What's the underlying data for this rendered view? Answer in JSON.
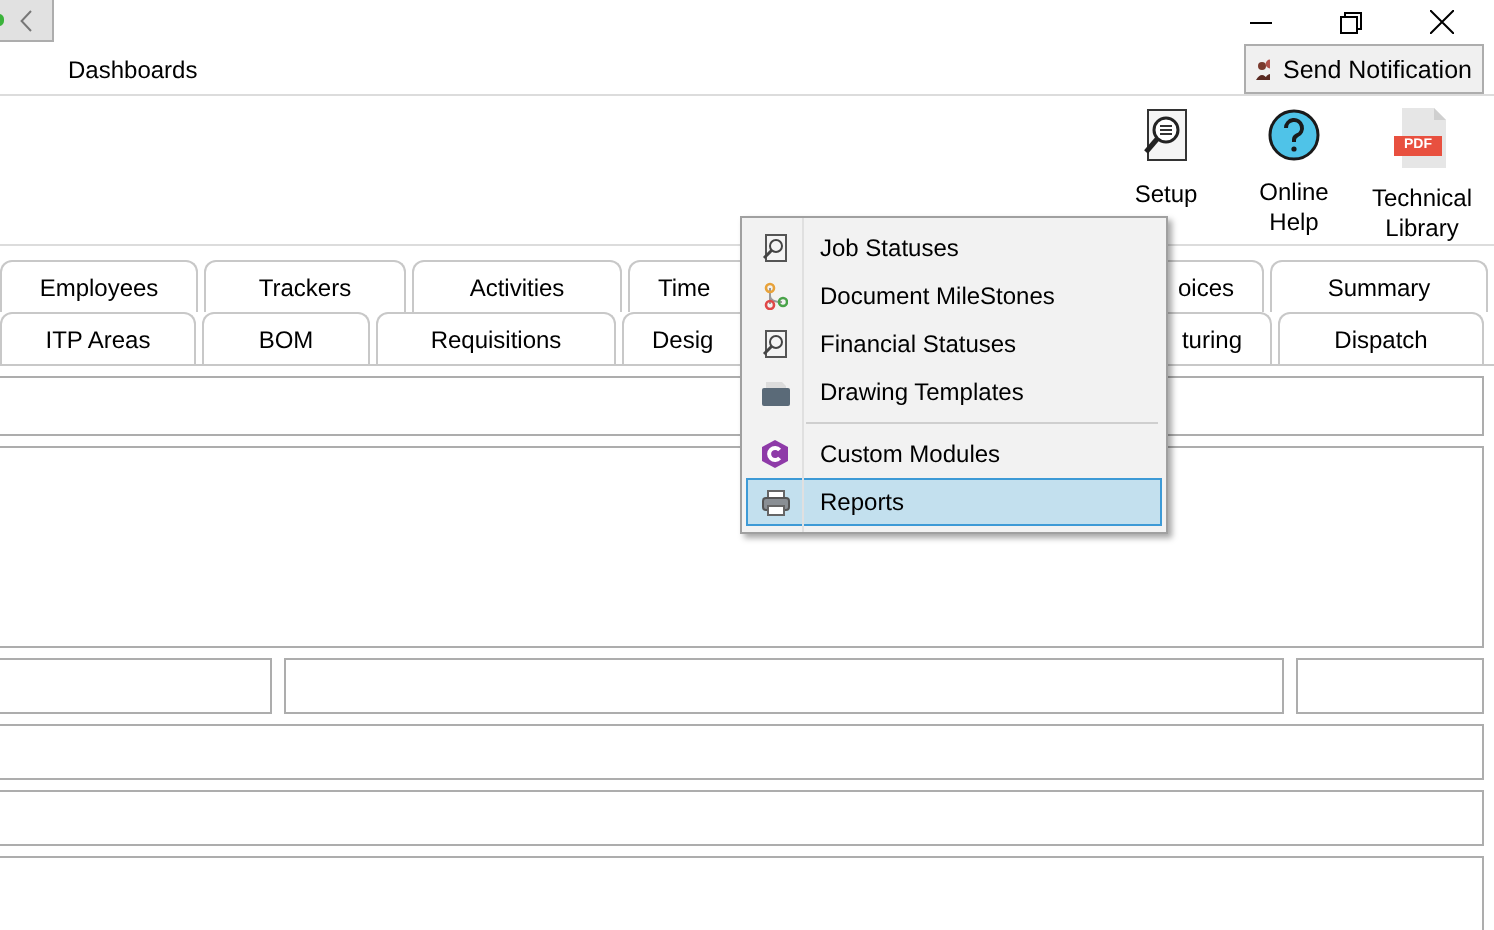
{
  "header": {
    "title": "Dashboards",
    "send_button": "Send Notification"
  },
  "toolbar": [
    {
      "label": "Setup"
    },
    {
      "label": "Online Help"
    },
    {
      "label": "Technical Library",
      "badge": "PDF"
    }
  ],
  "tab_rows": [
    [
      {
        "label": "Employees"
      },
      {
        "label": "Trackers"
      },
      {
        "label": "Activities"
      },
      {
        "label": "Time",
        "kind": "cutend"
      },
      {
        "label": "oices",
        "kind": "cutstart"
      },
      {
        "label": "Summary"
      }
    ],
    [
      {
        "label": "ITP Areas"
      },
      {
        "label": "BOM"
      },
      {
        "label": "Requisitions"
      },
      {
        "label": "Desig",
        "kind": "cutend"
      },
      {
        "label": "turing",
        "kind": "cutstart"
      },
      {
        "label": "Dispatch"
      }
    ]
  ],
  "context_menu": {
    "items": [
      {
        "kind": "item",
        "label": "Job Statuses",
        "selected": false
      },
      {
        "kind": "item",
        "label": "Document MileStones",
        "selected": false
      },
      {
        "kind": "item",
        "label": "Financial Statuses",
        "selected": false
      },
      {
        "kind": "item",
        "label": "Drawing Templates",
        "selected": false
      },
      {
        "kind": "separator"
      },
      {
        "kind": "item",
        "label": "Custom Modules",
        "selected": false
      },
      {
        "kind": "item",
        "label": "Reports",
        "selected": true
      }
    ]
  }
}
